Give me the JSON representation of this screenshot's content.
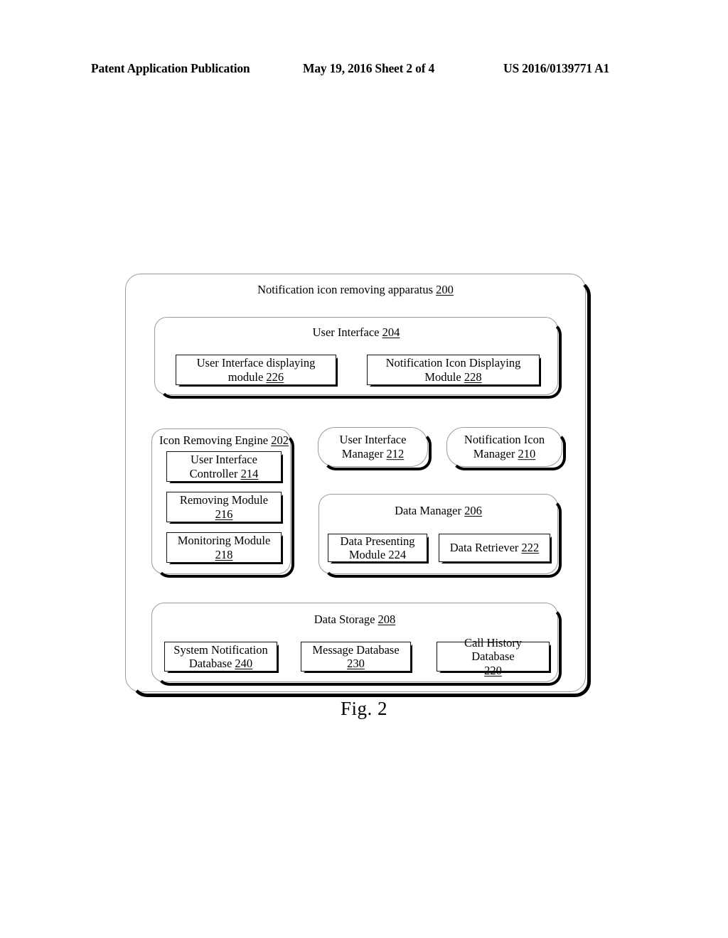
{
  "header": {
    "left": "Patent Application Publication",
    "middle": "May 19, 2016  Sheet 2 of 4",
    "right": "US 2016/0139771 A1"
  },
  "figure": {
    "caption": "Fig. 2"
  },
  "diagram": {
    "apparatus": {
      "title_text": "Notification icon removing apparatus ",
      "title_ref": "200"
    },
    "user_interface": {
      "title_text": "User Interface ",
      "title_ref": "204",
      "modules": [
        {
          "label": "User Interface displaying\nmodule ",
          "ref": "226"
        },
        {
          "label": "Notification Icon Displaying\nModule  ",
          "ref": "228"
        }
      ]
    },
    "icon_removing_engine": {
      "title_text": "Icon Removing Engine ",
      "title_ref": "202",
      "modules": [
        {
          "label": "User Interface\nController  ",
          "ref": "214"
        },
        {
          "label": "Removing Module\n",
          "ref": "216"
        },
        {
          "label": "Monitoring Module\n",
          "ref": "218"
        }
      ]
    },
    "user_interface_manager": {
      "label": "User Interface\nManager  ",
      "ref": "212"
    },
    "notification_icon_manager": {
      "label": "Notification Icon\nManager  ",
      "ref": "210"
    },
    "data_manager": {
      "title_text": "Data Manager  ",
      "title_ref": "206",
      "modules": [
        {
          "label": "Data Presenting\nModule 224",
          "ref": ""
        },
        {
          "label": "Data Retriever  ",
          "ref": "222"
        }
      ]
    },
    "data_storage": {
      "title_text": "Data Storage ",
      "title_ref": "208",
      "modules": [
        {
          "label": "System Notification\nDatabase  ",
          "ref": "240"
        },
        {
          "label": "Message Database\n",
          "ref": "230"
        },
        {
          "label": "Call History Database\n",
          "ref": "220"
        }
      ]
    }
  }
}
